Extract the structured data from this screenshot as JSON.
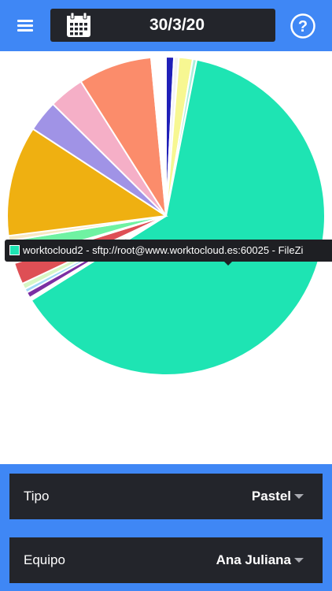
{
  "header": {
    "menu_icon": "hamburger-menu-icon",
    "calendar_icon": "calendar-icon",
    "date": "30/3/20",
    "help_icon": "help-circle-icon"
  },
  "chart_data": {
    "type": "pie",
    "title": "",
    "slices": [
      {
        "label": "",
        "value": 0.8,
        "color": "#1f1fb8"
      },
      {
        "label": "",
        "value": 0.5,
        "color": "#f3f3f3"
      },
      {
        "label": "",
        "value": 1.4,
        "color": "#f7f792"
      },
      {
        "label": "",
        "value": 0.4,
        "color": "#a8f0dc"
      },
      {
        "label": "worktocloud2 - sftp://root@www.worktocloud.es:60025 - FileZi",
        "value": 63.0,
        "color": "#1ee4b3"
      },
      {
        "label": "",
        "value": 0.3,
        "color": "#ffffff"
      },
      {
        "label": "",
        "value": 0.6,
        "color": "#7b2fa3"
      },
      {
        "label": "",
        "value": 0.4,
        "color": "#9fd9f7"
      },
      {
        "label": "",
        "value": 0.6,
        "color": "#d7f7c4"
      },
      {
        "label": "",
        "value": 2.2,
        "color": "#de4f55"
      },
      {
        "label": "",
        "value": 0.3,
        "color": "#f1f1c8"
      },
      {
        "label": "",
        "value": 2.0,
        "color": "#6ff2a2"
      },
      {
        "label": "",
        "value": 0.5,
        "color": "#f7e8c2"
      },
      {
        "label": "",
        "value": 11.2,
        "color": "#efb011"
      },
      {
        "label": "",
        "value": 3.2,
        "color": "#a093e6"
      },
      {
        "label": "",
        "value": 3.6,
        "color": "#f5afc7"
      },
      {
        "label": "",
        "value": 7.5,
        "color": "#fb8c6b"
      },
      {
        "label": "",
        "value": 1.5,
        "color": "#ffffff"
      }
    ],
    "tooltip": {
      "text": "worktocloud2 - sftp://root@www.worktocloud.es:60025 - FileZi",
      "color": "#1ee4b3"
    }
  },
  "filters": {
    "tipo": {
      "label": "Tipo",
      "value": "Pastel"
    },
    "equipo": {
      "label": "Equipo",
      "value": "Ana Juliana"
    }
  },
  "colors": {
    "header_bg": "#3f87f5",
    "panel_dark": "#23252b",
    "accent": "#1ee4b3"
  }
}
